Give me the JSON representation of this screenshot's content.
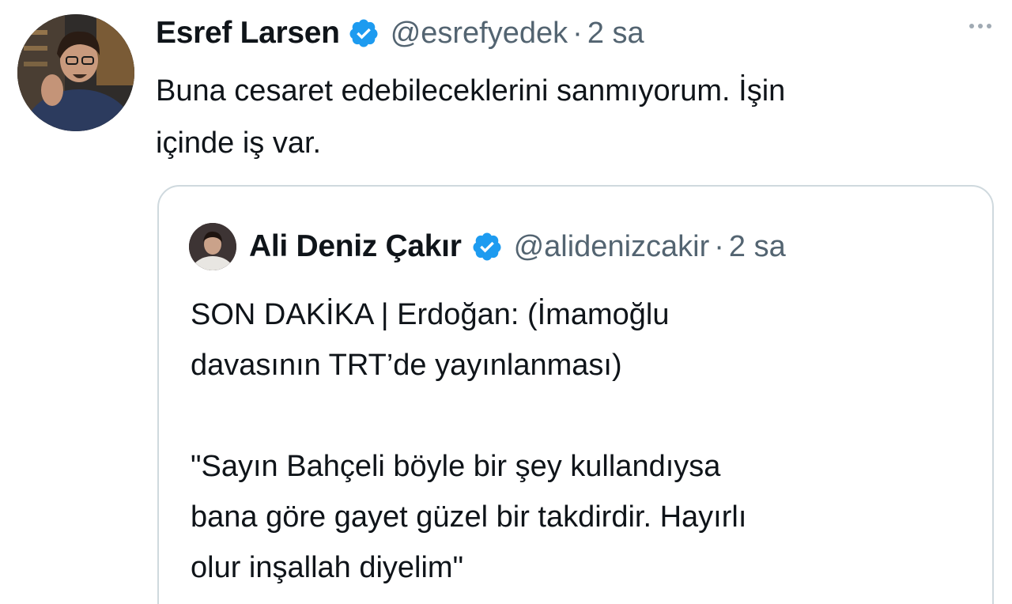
{
  "tweet": {
    "author_name": "Esref Larsen",
    "handle": "@esrefyedek",
    "separator": "·",
    "time": "2 sa",
    "text_line1": "Buna cesaret edebileceklerini sanmıyorum. İşin",
    "text_line2": "içinde iş var.",
    "more_icon": "more-dots-icon",
    "verified_icon": "verified-badge-icon"
  },
  "quoted_tweet": {
    "author_name": "Ali Deniz Çakır",
    "handle": "@alidenizcakir",
    "separator": "·",
    "time": "2 sa",
    "lines": [
      "SON DAKİKA | Erdoğan: (İmamoğlu",
      "davasının TRT’de yayınlanması)",
      "",
      "\"Sayın Bahçeli böyle bir şey kullandıysa",
      "bana göre gayet güzel bir takdirdir. Hayırlı",
      "olur inşallah diyelim\""
    ],
    "verified_icon": "verified-badge-icon"
  },
  "colors": {
    "text": "#0f1419",
    "secondary_text": "#536471",
    "verified": "#1d9bf0",
    "border": "#cfd9de"
  }
}
